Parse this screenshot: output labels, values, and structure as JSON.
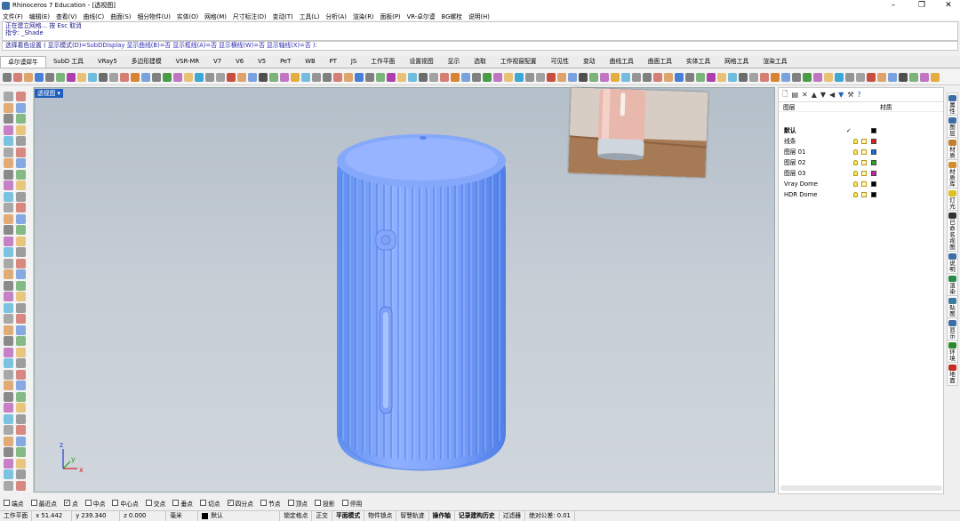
{
  "window": {
    "title": "Rhinoceros 7 Education - [透视图]"
  },
  "menu": [
    "文件(F)",
    "编辑(E)",
    "查看(V)",
    "曲线(C)",
    "曲面(S)",
    "细分物件(U)",
    "实体(O)",
    "网格(M)",
    "尺寸标注(D)",
    "变动(T)",
    "工具(L)",
    "分析(A)",
    "渲染(R)",
    "面板(P)",
    "VR-卓尔谟",
    "BG螺栓",
    "说明(H)"
  ],
  "command": {
    "history": [
      "正在建立网格... 按 Esc 取消",
      "指令: _Shade"
    ],
    "prompt": "选择着色设置 ( 显示模式(D)=",
    "options": "SubDDisplay 显示曲线(B)=否 显示框线(A)=否 显示横线(W)=否 显示轴线(X)=否 ):"
  },
  "tabs": [
    "卓尔谟犀牛",
    "SubD 工具",
    "VRay5",
    "多边形建模",
    "VSR-MR",
    "V7",
    "V6",
    "V5",
    "PeT",
    "WB",
    "PT",
    "JS",
    "工作平面",
    "设置视图",
    "显示",
    "选取",
    "工作视窗配置",
    "可见性",
    "变动",
    "曲线工具",
    "曲面工具",
    "实体工具",
    "网格工具",
    "渲染工具"
  ],
  "viewport": {
    "label": "透视图 ▾",
    "axis_x": "x",
    "axis_y": "y",
    "axis_z": "z"
  },
  "layers": {
    "header_name": "图层",
    "header_material": "材质",
    "rows": [
      {
        "name": "默认",
        "color": "#000000",
        "current": "✓",
        "bold": true
      },
      {
        "name": "线条",
        "color": "#e02020"
      },
      {
        "name": "图层 01",
        "color": "#2266dd"
      },
      {
        "name": "图层 02",
        "color": "#22aa22"
      },
      {
        "name": "图层 03",
        "color": "#cc22aa"
      },
      {
        "name": "Vray Dome",
        "color": "#000000"
      },
      {
        "name": "HDR Dome",
        "color": "#000000"
      }
    ]
  },
  "side_tabs": [
    "属性",
    "图层",
    "材质",
    "材质库",
    "灯光",
    "已命名视图",
    "说明",
    "渲染",
    "贴图",
    "显示",
    "环境",
    "地面"
  ],
  "osnap": [
    {
      "label": "端点",
      "checked": false
    },
    {
      "label": "最近点",
      "checked": false
    },
    {
      "label": "点",
      "checked": true
    },
    {
      "label": "中点",
      "checked": false
    },
    {
      "label": "中心点",
      "checked": false
    },
    {
      "label": "交点",
      "checked": false
    },
    {
      "label": "垂点",
      "checked": false
    },
    {
      "label": "切点",
      "checked": false
    },
    {
      "label": "四分点",
      "checked": true
    },
    {
      "label": "节点",
      "checked": false
    },
    {
      "label": "顶点",
      "checked": false
    },
    {
      "label": "投影",
      "checked": false
    },
    {
      "label": "停用",
      "checked": false
    }
  ],
  "status": {
    "cplane": "工作平面",
    "x": "x 51.442",
    "y": "y 239.340",
    "z": "z 0.000",
    "unit": "毫米",
    "layer": "默认",
    "items": [
      "锁定格点",
      "正交",
      "平面模式",
      "物件锁点",
      "智慧轨迹",
      "操作轴",
      "记录建构历史",
      "过滤器",
      "绝对公差: 0.01"
    ]
  }
}
